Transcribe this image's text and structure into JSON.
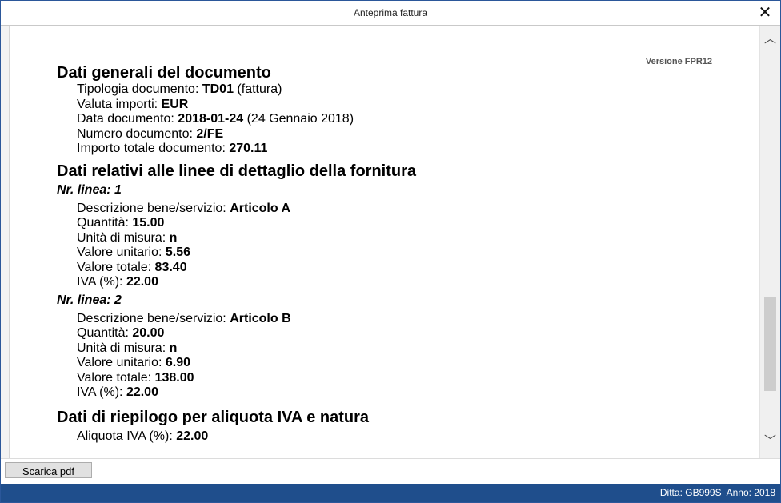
{
  "window": {
    "title": "Anteprima fattura",
    "close_glyph": "✕"
  },
  "document": {
    "version": "Versione FPR12",
    "general": {
      "heading": "Dati generali del documento",
      "rows": [
        {
          "label": "Tipologia documento: ",
          "value": "TD01",
          "note": " (fattura)"
        },
        {
          "label": "Valuta importi: ",
          "value": "EUR",
          "note": ""
        },
        {
          "label": "Data documento: ",
          "value": "2018-01-24",
          "note": " (24 Gennaio 2018)"
        },
        {
          "label": "Numero documento: ",
          "value": "2/FE",
          "note": ""
        },
        {
          "label": "Importo totale documento: ",
          "value": "270.11",
          "note": ""
        }
      ]
    },
    "lines": {
      "heading": "Dati relativi alle linee di dettaglio della fornitura",
      "items": [
        {
          "title": "Nr. linea: 1",
          "rows": [
            {
              "label": "Descrizione bene/servizio: ",
              "value": "Articolo A"
            },
            {
              "label": "Quantità: ",
              "value": "15.00"
            },
            {
              "label": "Unità di misura: ",
              "value": "n"
            },
            {
              "label": "Valore unitario: ",
              "value": "5.56"
            },
            {
              "label": "Valore totale: ",
              "value": "83.40"
            },
            {
              "label": "IVA (%): ",
              "value": "22.00"
            }
          ]
        },
        {
          "title": "Nr. linea: 2",
          "rows": [
            {
              "label": "Descrizione bene/servizio: ",
              "value": "Articolo B"
            },
            {
              "label": "Quantità: ",
              "value": "20.00"
            },
            {
              "label": "Unità di misura: ",
              "value": "n"
            },
            {
              "label": "Valore unitario: ",
              "value": "6.90"
            },
            {
              "label": "Valore totale: ",
              "value": "138.00"
            },
            {
              "label": "IVA (%): ",
              "value": "22.00"
            }
          ]
        }
      ]
    },
    "summary": {
      "heading": "Dati di riepilogo per aliquota IVA e natura",
      "rows": [
        {
          "label": "Aliquota IVA (%): ",
          "value": "22.00"
        }
      ]
    }
  },
  "scroll": {
    "up_glyph": "︿",
    "down_glyph": "﹀"
  },
  "footer": {
    "pdf_button": "Scarica pdf"
  },
  "status": {
    "ditta": "Ditta: GB999S",
    "anno": "Anno: 2018"
  }
}
